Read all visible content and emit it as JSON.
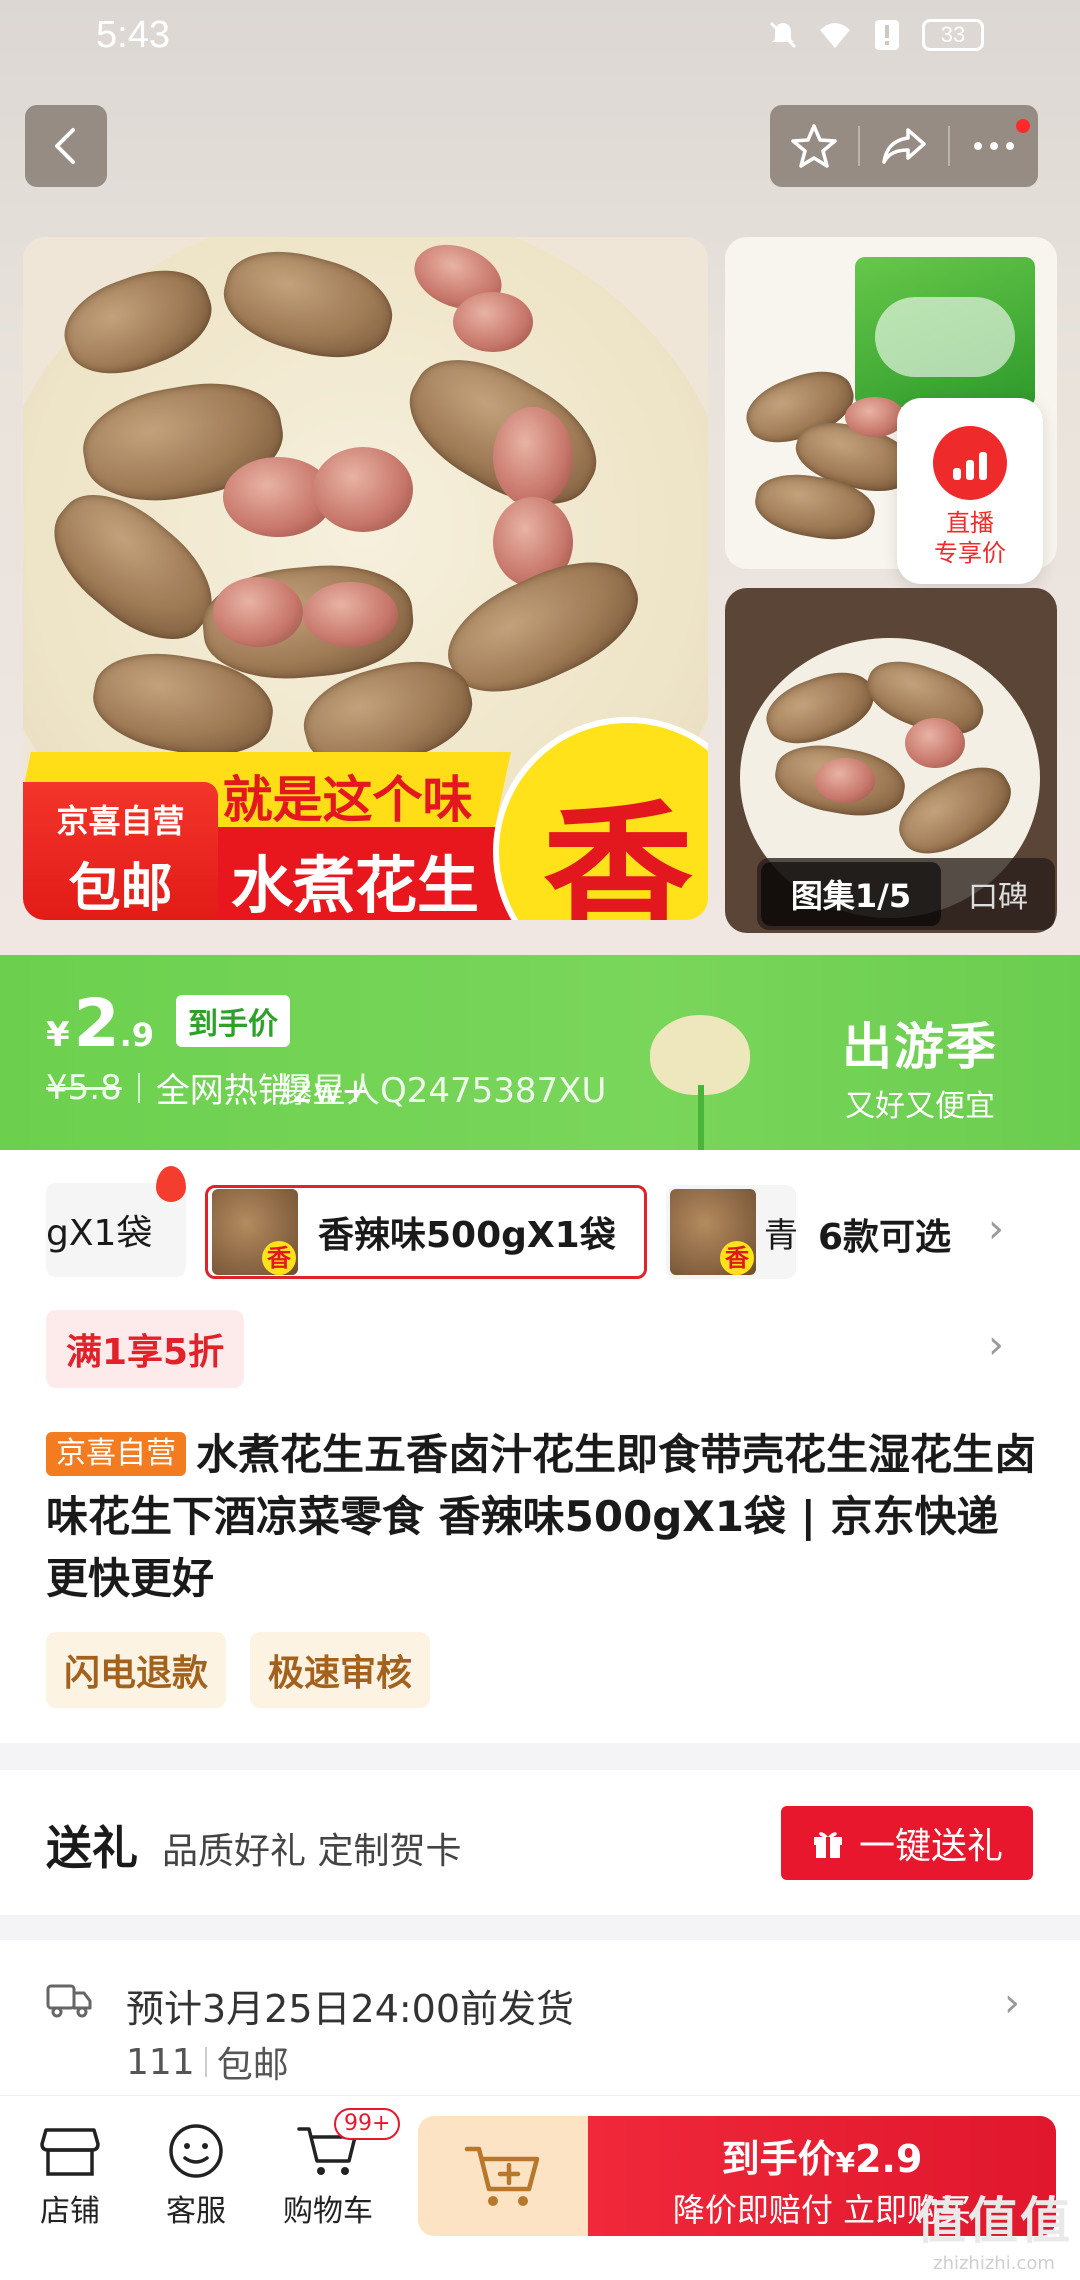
{
  "status_bar": {
    "time": "5:43",
    "battery": "33"
  },
  "gallery": {
    "main_banner_yellow": "就是这个味",
    "main_banner_red": "水煮花生",
    "main_big_char": "香",
    "badge_line1": "京喜自营",
    "badge_line2": "包邮",
    "live_label_line1": "直播",
    "live_label_line2": "专享价",
    "gallery_counter": "图集1/5",
    "reviews_tab": "口碑"
  },
  "price": {
    "currency": "¥",
    "integer": "2",
    "decimal": ".9",
    "tag": "到手价",
    "original": "¥5.8",
    "hot_sale": "全网热销2w+",
    "overlay_text": "爆星人Q2475387XU",
    "season_title": "出游季",
    "season_sub": "又好又便宜"
  },
  "sku": {
    "prev_label": "gX1袋",
    "selected_label": "香辣味500gX1袋",
    "next_label": "青",
    "more_label": "6款可选"
  },
  "promo": {
    "label": "满1享5折"
  },
  "product": {
    "store_tag": "京喜自营",
    "title": "水煮花生五香卤汁花生即食带壳花生湿花生卤味花生下酒凉菜零食 香辣味500gX1袋 | 京东快递 更快更好"
  },
  "service_tags": [
    "闪电退款",
    "极速审核"
  ],
  "gift": {
    "title": "送礼",
    "subtitle": "品质好礼 定制贺卡",
    "button": "一键送礼"
  },
  "shipping": {
    "line1": "预计3月25日24:00前发货",
    "from": "111",
    "free": "包邮"
  },
  "bottom_bar": {
    "shop": "店铺",
    "service": "客服",
    "cart": "购物车",
    "cart_badge": "99+",
    "buy_line1_prefix": "到手价",
    "buy_currency": "¥",
    "buy_price": "2.9",
    "buy_line2": "降价即赔付 立即购买"
  },
  "watermark": {
    "main": "值值值",
    "sub": "zhizhizhi.com"
  },
  "colors": {
    "accent_red": "#e8172d",
    "banner_green": "#6cd04e",
    "store_orange": "#f37b20"
  }
}
